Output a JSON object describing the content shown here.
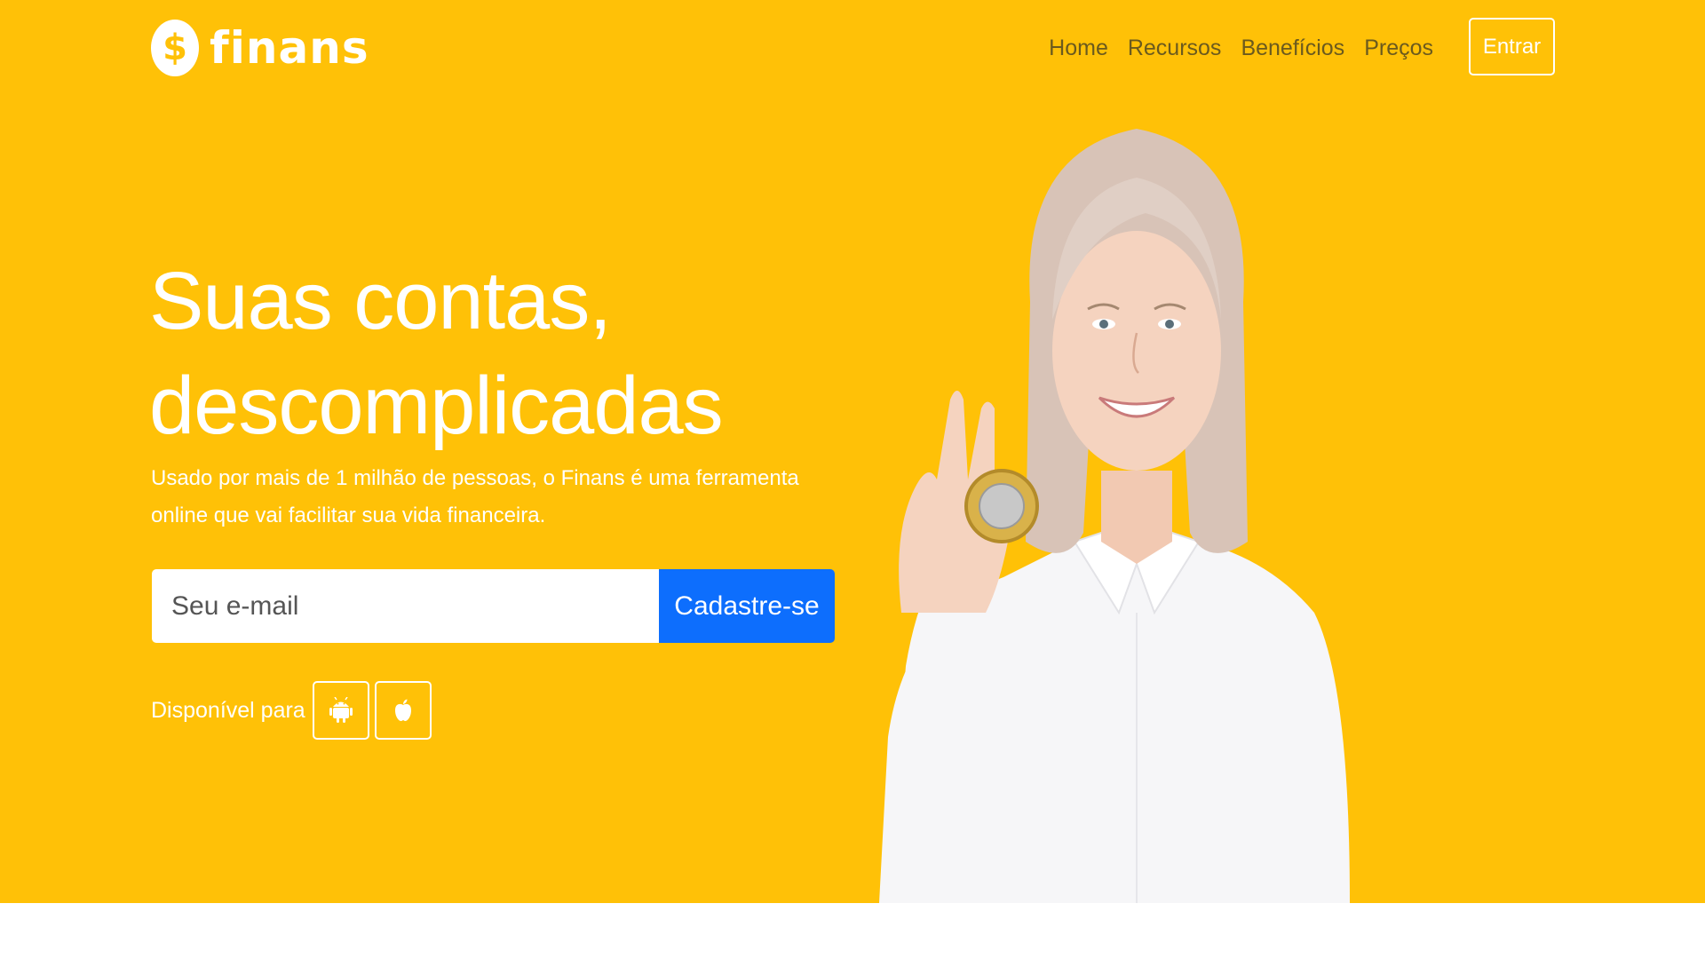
{
  "header": {
    "brand": "finans",
    "logo_symbol": "$",
    "nav": [
      "Home",
      "Recursos",
      "Benefícios",
      "Preços"
    ],
    "login_label": "Entrar"
  },
  "hero": {
    "headline_line1": "Suas contas,",
    "headline_line2": "descomplicadas",
    "subtitle": "Usado por mais de 1 milhão de pessoas, o Finans é uma ferramenta online que vai facilitar sua vida financeira.",
    "email_placeholder": "Seu e-mail",
    "signup_label": "Cadastre-se",
    "available_label": "Disponível para",
    "platform_icons": [
      "android-icon",
      "apple-icon"
    ]
  },
  "colors": {
    "hero_background": "#ffc107",
    "primary_button": "#0d6efd",
    "nav_text": "#6b5a1e"
  }
}
